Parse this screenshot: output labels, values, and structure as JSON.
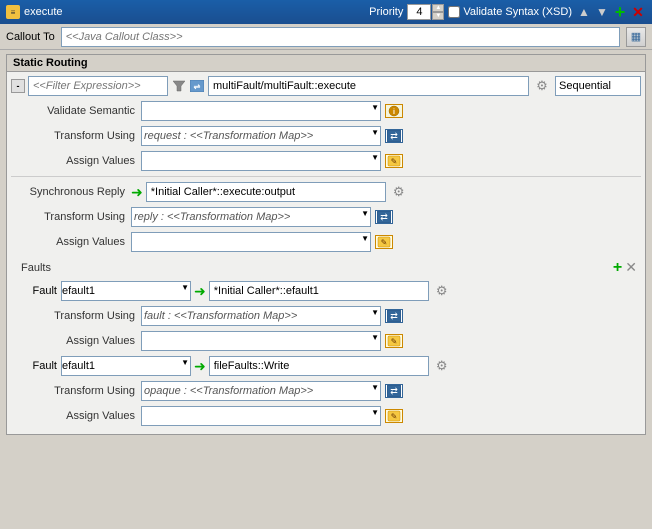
{
  "titleBar": {
    "icon": "≡",
    "title": "execute",
    "priorityLabel": "Priority",
    "priorityValue": "4",
    "validateLabel": "Validate Syntax (XSD)",
    "validateChecked": false
  },
  "toolbar": {
    "upLabel": "▲",
    "downLabel": "▼",
    "addLabel": "+",
    "deleteLabel": "✕"
  },
  "callout": {
    "label": "Callout To",
    "placeholder": "<<Java Callout Class>>",
    "btnIcon": "▦"
  },
  "staticRouting": {
    "panelTitle": "Static Routing",
    "collapseBtn": "-",
    "filterPlaceholder": "<<Filter Expression>>",
    "routeTarget": "multiFault/multiFault::execute",
    "sequentialLabel": "Sequential",
    "validateSemantic": {
      "label": "Validate Semantic",
      "value": ""
    },
    "transformUsing1": {
      "label": "Transform Using",
      "value": "request : <<Transformation Map>>"
    },
    "assignValues1": {
      "label": "Assign Values",
      "value": ""
    },
    "synchronousReply": {
      "label": "Synchronous Reply",
      "target": "*Initial Caller*::execute:output"
    },
    "transformUsing2": {
      "label": "Transform Using",
      "value": "reply : <<Transformation Map>>"
    },
    "assignValues2": {
      "label": "Assign Values",
      "value": ""
    },
    "faults": {
      "label": "Faults",
      "addIcon": "+",
      "deleteIcon": "✕"
    },
    "fault1": {
      "label": "Fault",
      "selectValue": "efault1",
      "target": "*Initial Caller*::efault1",
      "transformLabel": "Transform Using",
      "transformValue": "fault : <<Transformation Map>>",
      "assignLabel": "Assign Values",
      "assignValue": ""
    },
    "fault2": {
      "label": "Fault",
      "selectValue": "efault1",
      "target": "fileFaults::Write",
      "transformLabel": "Transform Using",
      "transformValue": "opaque : <<Transformation Map>>",
      "assignLabel": "Assign Values",
      "assignValue": ""
    }
  },
  "icons": {
    "filter": "▼",
    "gear": "⚙",
    "xsd": "XSD",
    "transform": "⇄",
    "assign": "✎",
    "arrowRight": "➜",
    "star": "★",
    "checkmark": "✓"
  }
}
